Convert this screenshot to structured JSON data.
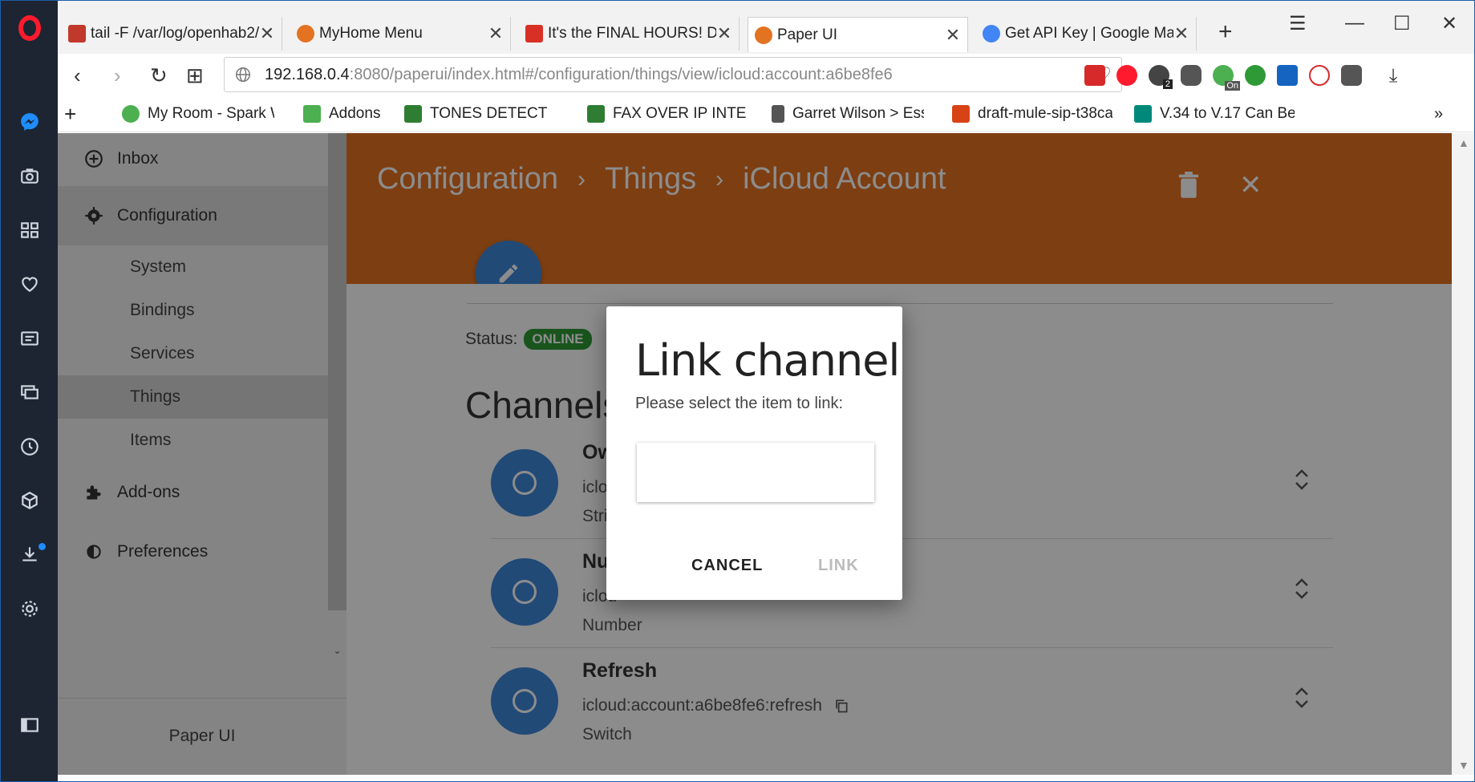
{
  "browser": {
    "tabs": [
      {
        "title": "tail -F /var/log/openhab2/",
        "icon": "terminal-icon",
        "color": "#c0392b"
      },
      {
        "title": "MyHome Menu",
        "icon": "openhab-icon",
        "color": "#e37221"
      },
      {
        "title": "It's the FINAL HOURS! Do",
        "icon": "gmail-icon",
        "color": "#d93025"
      },
      {
        "title": "Paper UI",
        "icon": "openhab-icon",
        "color": "#e37221"
      },
      {
        "title": "Get API Key | Google Ma",
        "icon": "google-icon",
        "color": "#4285f4"
      }
    ],
    "url_host": "192.168.0.4",
    "url_rest": ":8080/paperui/index.html#/configuration/things/view/icloud:account:a6be8fe6",
    "bookmarks": [
      "My Room - Spark W",
      "Addons",
      "TONES DETECTION (",
      "FAX OVER IP INTERO",
      "Garret Wilson > Essa",
      "draft-mule-sip-t38ca",
      "V.34 to V.17 Can Be"
    ],
    "ext_badge": "2",
    "ext_on": "On"
  },
  "sidebar": {
    "inbox": "Inbox",
    "configuration": "Configuration",
    "sub": [
      "System",
      "Bindings",
      "Services",
      "Things",
      "Items"
    ],
    "addons": "Add-ons",
    "preferences": "Preferences",
    "footer": "Paper UI"
  },
  "header": {
    "crumbs": [
      "Configuration",
      "Things",
      "iCloud Account"
    ]
  },
  "content": {
    "status_label": "Status:",
    "status_value": "ONLINE",
    "channels_title": "Channels",
    "channels": [
      {
        "name": "Ow",
        "uid": "iclou",
        "type": "Strin"
      },
      {
        "name": "Nu",
        "uid": "iclou",
        "type": "Number"
      },
      {
        "name": "Refresh",
        "uid": "icloud:account:a6be8fe6:refresh",
        "type": "Switch"
      }
    ]
  },
  "dialog": {
    "title": "Link channel",
    "subtitle": "Please select the item to link:",
    "input_value": "",
    "cancel": "CANCEL",
    "link": "LINK"
  }
}
